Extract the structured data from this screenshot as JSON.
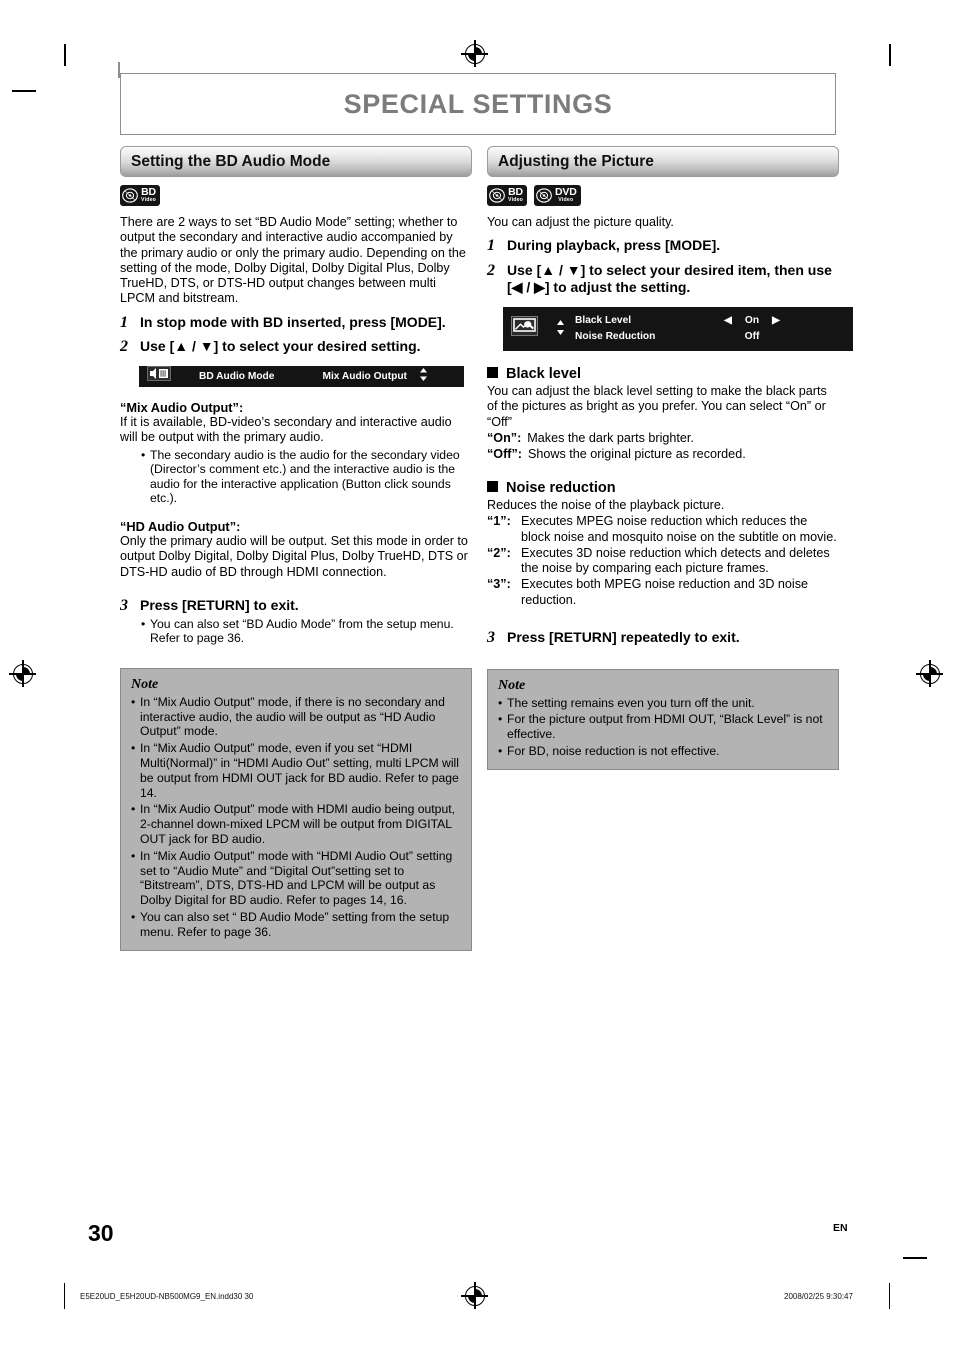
{
  "page": {
    "title": "SPECIAL SETTINGS",
    "page_number": "30",
    "language_code": "EN",
    "footer_file": "E5E20UD_E5H20UD-NB500MG9_EN.indd30   30",
    "footer_date": "2008/02/25   9:30:47"
  },
  "left": {
    "section_title": "Setting the BD Audio Mode",
    "disc_badges": [
      {
        "name": "BD",
        "sub": "Video"
      }
    ],
    "intro": "There are 2 ways to set “BD Audio Mode” setting; whether to output the secondary and interactive audio accompanied by the primary audio or only the primary audio. Depending on the setting of the mode, Dolby Digital, Dolby Digital Plus, Dolby TrueHD, DTS, or DTS-HD output changes between multi LPCM and bitstream.",
    "steps": [
      {
        "num": "1",
        "text": "In stop mode with BD inserted, press [MODE]."
      },
      {
        "num": "2",
        "text": "Use [▲ / ▼] to select your desired setting."
      },
      {
        "num": "3",
        "text": "Press [RETURN] to exit.",
        "bullets": [
          "You can also set “BD Audio Mode” from the setup menu. Refer to page 36."
        ]
      }
    ],
    "osd": {
      "item_label": "BD Audio Mode",
      "item_value": "Mix Audio Output",
      "updown_glyph": "⬍"
    },
    "mix_heading": "“Mix Audio Output”:",
    "mix_body": "If it is available, BD-video’s secondary and interactive audio will be output with the primary audio.",
    "mix_bullet": "The secondary audio is the audio for the secondary video (Director’s comment etc.) and the interactive audio is the audio for the interactive application (Button click sounds etc.).",
    "hd_heading": "“HD Audio Output”:",
    "hd_body": "Only the primary audio will be output. Set this mode in order to output Dolby Digital, Dolby Digital Plus, Dolby TrueHD, DTS or DTS-HD audio of BD through HDMI connection.",
    "note": {
      "title": "Note",
      "items": [
        "In “Mix Audio Output” mode, if there is no secondary and interactive audio, the audio will be output as “HD Audio Output” mode.",
        "In “Mix Audio Output” mode, even if you set “HDMI Multi(Normal)” in “HDMI Audio Out” setting, multi LPCM will be output from HDMI OUT jack for BD audio. Refer to page 14.",
        "In “Mix Audio Output” mode with HDMI audio being output, 2-channel down-mixed LPCM will be output from DIGITAL OUT jack for BD audio.",
        "In “Mix Audio Output” mode with “HDMI Audio Out” setting set to “Audio Mute” and  “Digital Out”setting set to “Bitstream”, DTS, DTS-HD and LPCM will be output as Dolby Digital for BD audio. Refer to pages 14, 16.",
        "You can also set “ BD Audio Mode” setting from the setup menu. Refer to page 36."
      ]
    }
  },
  "right": {
    "section_title": "Adjusting the Picture",
    "disc_badges": [
      {
        "name": "BD",
        "sub": "Video"
      },
      {
        "name": "DVD",
        "sub": "Video"
      }
    ],
    "intro": "You can adjust the picture quality.",
    "steps": [
      {
        "num": "1",
        "text": "During playback, press [MODE]."
      },
      {
        "num": "2",
        "text": "Use [▲ / ▼] to select your desired item, then use [◀ / ▶] to adjust the setting."
      },
      {
        "num": "3",
        "text": "Press [RETURN] repeatedly to exit."
      }
    ],
    "osd": {
      "rows": [
        {
          "label": "Black Level",
          "value": "On",
          "left_arrow": "◀",
          "right_arrow": "▶"
        },
        {
          "label": "Noise Reduction",
          "value": "Off",
          "left_arrow": "",
          "right_arrow": ""
        }
      ],
      "updown_glyph": "⬍"
    },
    "black_level": {
      "heading": "Black level",
      "body": "You can adjust the black level setting to make the black parts of the pictures as bright as you prefer. You can select “On” or “Off”",
      "options": [
        {
          "key": "“On”:",
          "desc": "Makes the dark parts brighter."
        },
        {
          "key": "“Off”:",
          "desc": "Shows the original picture as recorded."
        }
      ]
    },
    "noise_reduction": {
      "heading": "Noise reduction",
      "body": "Reduces the noise of the playback picture.",
      "options": [
        {
          "key": "“1”:",
          "desc": "Executes MPEG noise reduction which reduces the block noise and mosquito noise on the subtitle on movie."
        },
        {
          "key": "“2”:",
          "desc": "Executes 3D noise reduction which detects and deletes the noise by comparing each picture frames."
        },
        {
          "key": "“3”:",
          "desc": "Executes both MPEG noise reduction and 3D noise reduction."
        }
      ]
    },
    "note": {
      "title": "Note",
      "items": [
        "The setting remains even you turn off the unit.",
        "For the picture output from HDMI OUT, “Black Level” is not effective.",
        "For BD, noise reduction is not effective."
      ]
    }
  }
}
